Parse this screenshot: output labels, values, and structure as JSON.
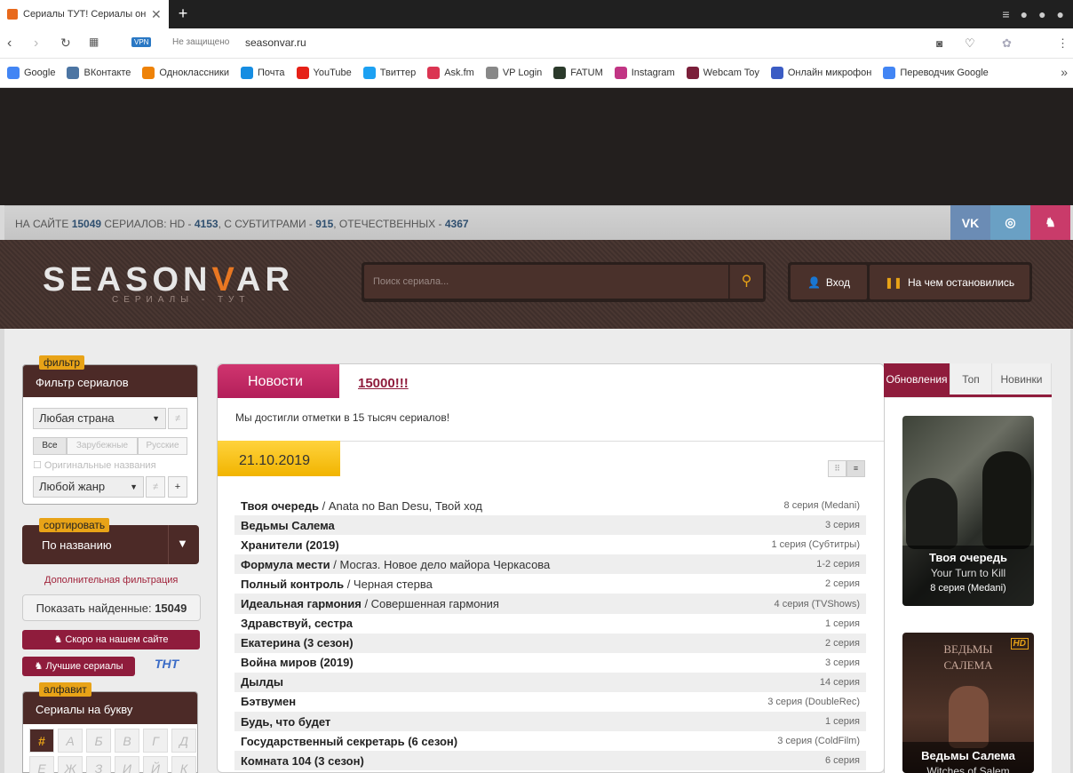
{
  "browser": {
    "tab_title": "Сериалы ТУТ! Сериалы онлайн",
    "vpn": "VPN",
    "security": "Не защищено",
    "url": "seasonvar.ru",
    "bookmarks": [
      {
        "label": "Google",
        "color": "#4285f4"
      },
      {
        "label": "ВКонтакте",
        "color": "#4c75a3"
      },
      {
        "label": "Одноклассники",
        "color": "#ee8208"
      },
      {
        "label": "Почта",
        "color": "#168de2"
      },
      {
        "label": "YouTube",
        "color": "#e62117"
      },
      {
        "label": "Твиттер",
        "color": "#1da1f2"
      },
      {
        "label": "Ask.fm",
        "color": "#db3552"
      },
      {
        "label": "VP Login",
        "color": "#888888"
      },
      {
        "label": "FATUM",
        "color": "#2b3a2b"
      },
      {
        "label": "Instagram",
        "color": "#c13584"
      },
      {
        "label": "Webcam Toy",
        "color": "#7b1f3a"
      },
      {
        "label": "Онлайн микрофон",
        "color": "#3b5cc4"
      },
      {
        "label": "Переводчик Google",
        "color": "#4285f4"
      }
    ]
  },
  "stats": {
    "p1": "НА САЙТЕ ",
    "total": "15049",
    "p2": " СЕРИАЛОВ: HD - ",
    "hd": "4153",
    "p3": ", С СУБТИТРАМИ - ",
    "subs": "915",
    "p4": ", ОТЕЧЕСТВЕННЫХ - ",
    "domestic": "4367"
  },
  "social": {
    "vk": "VK",
    "colors": {
      "vk": "#6b8cb5",
      "ok": "#6aa0c4",
      "cat": "#c93b6a"
    }
  },
  "header": {
    "logo_a": "SEASON",
    "logo_b": "V",
    "logo_c": "AR",
    "logo_sub": "СЕРИАЛЫ - ТУТ",
    "search_placeholder": "Поиск сериала...",
    "login": "Вход",
    "stopped": "На чем остановились"
  },
  "filter": {
    "badge": "фильтр",
    "title": "Фильтр сериалов",
    "country": "Любая страна",
    "seg": [
      "Все",
      "Зарубежные",
      "Русские"
    ],
    "original": "Оригинальные названия",
    "genre": "Любой жанр",
    "ne": "≠",
    "plus": "+"
  },
  "sort": {
    "badge": "сортировать",
    "value": "По названию"
  },
  "extra_filter": "Дополнительная фильтрация",
  "show_found": {
    "label": "Показать найденные: ",
    "count": "15049"
  },
  "soon": "Скоро на нашем сайте",
  "best": "Лучшие сериалы",
  "tnt": "ТНТ",
  "alphabet": {
    "badge": "алфавит",
    "title": "Сериалы на букву",
    "letters": [
      "#",
      "А",
      "Б",
      "В",
      "Г",
      "Д",
      "Е",
      "Ж",
      "З",
      "И",
      "Й",
      "К"
    ]
  },
  "news": {
    "tab": "Новости",
    "link": "15000!!!",
    "text": "Мы достигли отметки в 15 тысяч сериалов!"
  },
  "date": "21.10.2019",
  "episodes": [
    {
      "name": "Твоя очередь",
      "orig": " / Anata no Ban Desu, Твой ход",
      "ep": "8 серия (Medani)"
    },
    {
      "name": "Ведьмы Салема",
      "orig": "",
      "ep": "3 серия"
    },
    {
      "name": "Хранители (2019)",
      "orig": "",
      "ep": "1 серия (Субтитры)"
    },
    {
      "name": "Формула мести",
      "orig": " / Мосгаз. Новое дело майора Черкасова",
      "ep": "1-2 серия"
    },
    {
      "name": "Полный контроль",
      "orig": " / Черная стерва",
      "ep": "2 серия"
    },
    {
      "name": "Идеальная гармония",
      "orig": " / Совершенная гармония",
      "ep": "4 серия (TVShows)"
    },
    {
      "name": "Здравствуй, сестра",
      "orig": "",
      "ep": "1 серия"
    },
    {
      "name": "Екатерина (3 сезон)",
      "orig": "",
      "ep": "2 серия"
    },
    {
      "name": "Война миров (2019)",
      "orig": "",
      "ep": "3 серия"
    },
    {
      "name": "Дылды",
      "orig": "",
      "ep": "14 серия"
    },
    {
      "name": "Бэтвумен",
      "orig": "",
      "ep": "3 серия (DoubleRec)"
    },
    {
      "name": "Будь, что будет",
      "orig": "",
      "ep": "1 серия"
    },
    {
      "name": "Государственный секретарь (6 сезон)",
      "orig": "",
      "ep": "3 серия (ColdFilm)"
    },
    {
      "name": "Комната 104 (3 сезон)",
      "orig": "",
      "ep": "6 серия"
    }
  ],
  "right_tabs": [
    "Обновления",
    "Топ",
    "Новинки"
  ],
  "cards": [
    {
      "title": "Твоя очередь",
      "orig": "Your Turn to Kill",
      "ep": "8 серия (Medani)"
    },
    {
      "title": "Ведьмы Салема",
      "orig": "Witches of Salem",
      "hd": "HD",
      "poster": "ВЕДЬМЫ САЛЕМА"
    }
  ]
}
